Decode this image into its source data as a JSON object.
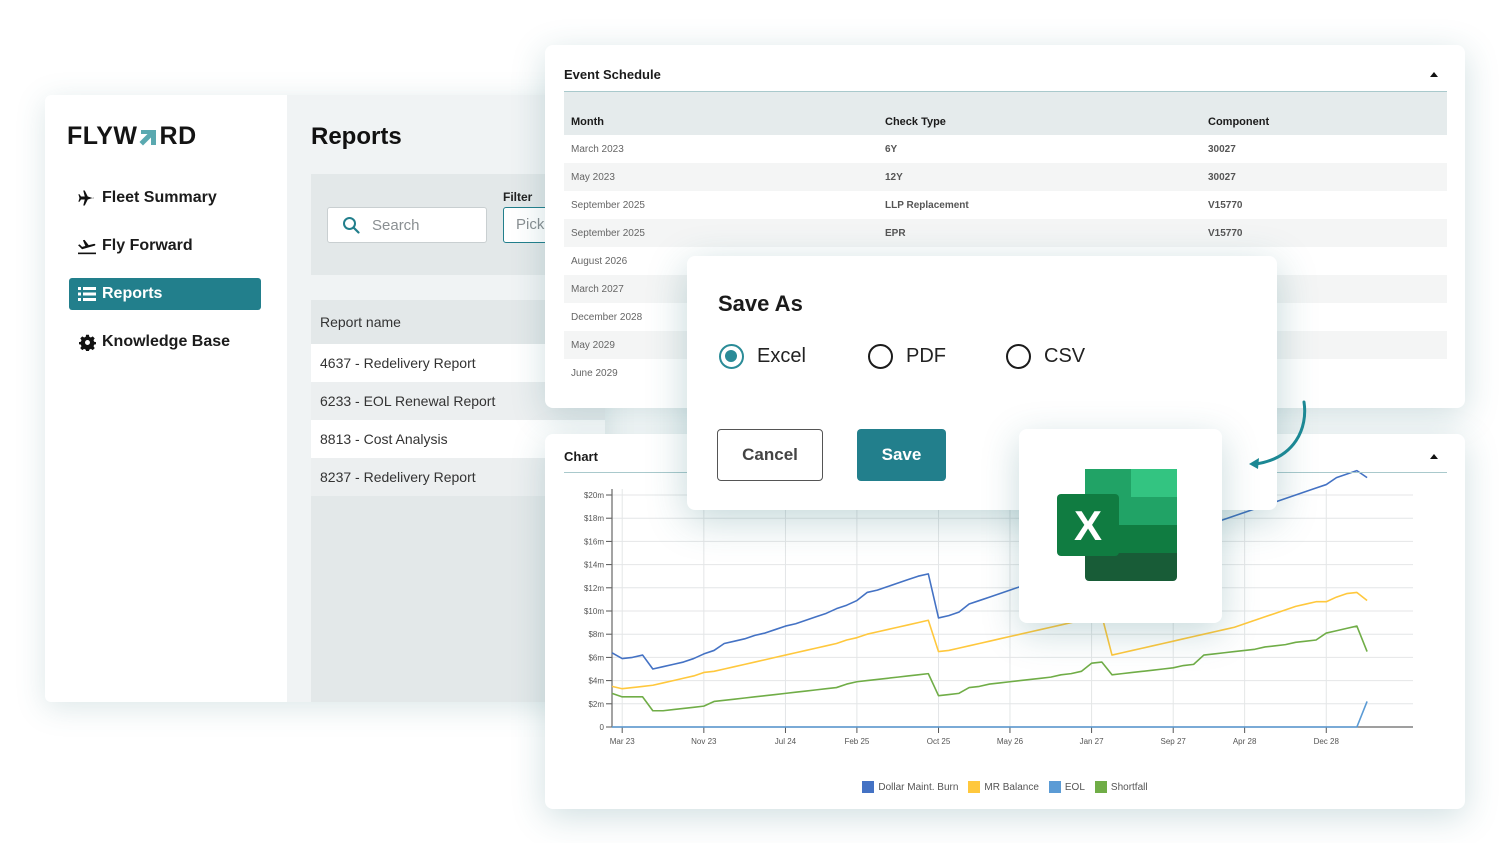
{
  "app": {
    "logo": {
      "left": "FLYW",
      "right": "RD",
      "accent": "#5aa9b0"
    },
    "sidebar": {
      "items": [
        {
          "label": "Fleet Summary",
          "icon": "plane-icon",
          "active": false
        },
        {
          "label": "Fly Forward",
          "icon": "plane-departure-icon",
          "active": false
        },
        {
          "label": "Reports",
          "icon": "list-icon",
          "active": true
        },
        {
          "label": "Knowledge Base",
          "icon": "gear-icon",
          "active": false
        }
      ]
    },
    "main": {
      "title": "Reports",
      "search": {
        "placeholder": "Search"
      },
      "filter": {
        "label": "Filter",
        "placeholder": "Pick"
      },
      "report_table": {
        "header": "Report name",
        "rows": [
          "4637 - Redelivery Report",
          "6233 - EOL Renewal Report",
          "8813 - Cost Analysis",
          "8237 - Redelivery Report"
        ]
      }
    }
  },
  "event_schedule": {
    "title": "Event Schedule",
    "columns": [
      "Month",
      "Check Type",
      "Component"
    ],
    "rows": [
      [
        "March 2023",
        "6Y",
        "30027"
      ],
      [
        "May 2023",
        "12Y",
        "30027"
      ],
      [
        "September 2025",
        "LLP Replacement",
        "V15770"
      ],
      [
        "September 2025",
        "EPR",
        "V15770"
      ],
      [
        "August 2026",
        "",
        ""
      ],
      [
        "March 2027",
        "",
        ""
      ],
      [
        "December 2028",
        "",
        ""
      ],
      [
        "May 2029",
        "",
        ""
      ],
      [
        "June 2029",
        "",
        ""
      ]
    ]
  },
  "dialog": {
    "title": "Save As",
    "options": [
      "Excel",
      "PDF",
      "CSV"
    ],
    "selected": "Excel",
    "cancel_label": "Cancel",
    "save_label": "Save"
  },
  "excel_card": {
    "icon": "excel-icon",
    "letter": "X"
  },
  "colors": {
    "accent": "#227f8c",
    "burn": "#4472c4",
    "mr_balance": "#ffc83d",
    "eol": "#5b9bd5",
    "shortfall": "#70ad47"
  },
  "chart_panel": {
    "title": "Chart"
  },
  "chart_data": {
    "type": "line",
    "title": "Chart",
    "xlabel": "",
    "ylabel": "",
    "ylim": [
      0,
      20
    ],
    "y_unit": "$m",
    "y_ticks": [
      "0",
      "$2m",
      "$4m",
      "$6m",
      "$8m",
      "$10m",
      "$12m",
      "$14m",
      "$16m",
      "$18m",
      "$20m"
    ],
    "x_ticks": [
      "Mar 23",
      "Nov 23",
      "Jul 24",
      "Feb 25",
      "Oct 25",
      "May 26",
      "Jan 27",
      "Sep 27",
      "Apr 28",
      "Dec 28"
    ],
    "x_tick_month_index": [
      1,
      9,
      17,
      24,
      32,
      39,
      47,
      55,
      62,
      70
    ],
    "x_range_months": [
      0,
      78.5
    ],
    "grid": true,
    "legend_position": "bottom",
    "x": [
      "Feb 23",
      "Mar 23",
      "Apr 23",
      "May 23",
      "Jun 23",
      "Jul 23",
      "Aug 23",
      "Sep 23",
      "Oct 23",
      "Nov 23",
      "Dec 23",
      "Jan 24",
      "Feb 24",
      "Mar 24",
      "Apr 24",
      "May 24",
      "Jun 24",
      "Jul 24",
      "Aug 24",
      "Sep 24",
      "Oct 24",
      "Nov 24",
      "Dec 24",
      "Jan 25",
      "Feb 25",
      "Mar 25",
      "Apr 25",
      "May 25",
      "Jun 25",
      "Jul 25",
      "Aug 25",
      "Sep 25",
      "Oct 25",
      "Nov 25",
      "Dec 25",
      "Jan 26",
      "Feb 26",
      "Mar 26",
      "Apr 26",
      "May 26",
      "Jun 26",
      "Jul 26",
      "Aug 26",
      "Sep 26",
      "Oct 26",
      "Nov 26",
      "Dec 26",
      "Jan 27",
      "Feb 27",
      "Mar 27",
      "Apr 27",
      "May 27",
      "Jun 27",
      "Jul 27",
      "Aug 27",
      "Sep 27",
      "Oct 27",
      "Nov 27",
      "Dec 27",
      "Jan 28",
      "Feb 28",
      "Mar 28",
      "Apr 28",
      "May 28",
      "Jun 28",
      "Jul 28",
      "Aug 28",
      "Sep 28",
      "Oct 28",
      "Nov 28",
      "Dec 28",
      "Jan 29",
      "Feb 29",
      "Mar 29",
      "Apr 29"
    ],
    "series": [
      {
        "name": "Dollar Maint. Burn",
        "color": "#4472c4",
        "values": [
          6.4,
          5.9,
          6.0,
          6.2,
          5.0,
          5.2,
          5.4,
          5.6,
          5.9,
          6.3,
          6.6,
          7.2,
          7.4,
          7.6,
          7.9,
          8.1,
          8.4,
          8.7,
          8.9,
          9.2,
          9.5,
          9.8,
          10.2,
          10.5,
          10.9,
          11.6,
          11.8,
          12.1,
          12.4,
          12.7,
          13.0,
          13.2,
          9.4,
          9.6,
          9.9,
          10.6,
          10.9,
          11.2,
          11.5,
          11.8,
          12.1,
          12.4,
          12.6,
          12.9,
          13.2,
          13.5,
          13.8,
          14.2,
          14.4,
          14.6,
          14.9,
          15.2,
          15.5,
          15.8,
          16.1,
          16.5,
          16.8,
          17.1,
          17.4,
          17.6,
          17.9,
          18.2,
          18.5,
          18.8,
          19.1,
          19.4,
          19.7,
          20.0,
          20.3,
          20.6,
          20.9,
          21.5,
          21.8,
          22.1,
          21.5
        ]
      },
      {
        "name": "MR Balance",
        "color": "#ffc83d",
        "values": [
          3.5,
          3.3,
          3.4,
          3.5,
          3.6,
          3.8,
          4.0,
          4.2,
          4.4,
          4.7,
          4.8,
          5.0,
          5.2,
          5.4,
          5.6,
          5.8,
          6.0,
          6.2,
          6.4,
          6.6,
          6.8,
          7.0,
          7.2,
          7.5,
          7.7,
          8.0,
          8.2,
          8.4,
          8.6,
          8.8,
          9.0,
          9.2,
          6.5,
          6.6,
          6.8,
          7.0,
          7.2,
          7.4,
          7.6,
          7.8,
          8.0,
          8.2,
          8.4,
          8.6,
          8.8,
          9.0,
          9.2,
          9.4,
          9.6,
          6.2,
          6.4,
          6.6,
          6.8,
          7.0,
          7.2,
          7.4,
          7.6,
          7.8,
          8.0,
          8.2,
          8.4,
          8.6,
          8.9,
          9.2,
          9.5,
          9.8,
          10.1,
          10.4,
          10.6,
          10.8,
          10.8,
          11.2,
          11.5,
          11.6,
          10.9
        ]
      },
      {
        "name": "EOL",
        "color": "#5b9bd5",
        "values": [
          0,
          0,
          0,
          0,
          0,
          0,
          0,
          0,
          0,
          0,
          0,
          0,
          0,
          0,
          0,
          0,
          0,
          0,
          0,
          0,
          0,
          0,
          0,
          0,
          0,
          0,
          0,
          0,
          0,
          0,
          0,
          0,
          0,
          0,
          0,
          0,
          0,
          0,
          0,
          0,
          0,
          0,
          0,
          0,
          0,
          0,
          0,
          0,
          0,
          0,
          0,
          0,
          0,
          0,
          0,
          0,
          0,
          0,
          0,
          0,
          0,
          0,
          0,
          0,
          0,
          0,
          0,
          0,
          0,
          0,
          0,
          0,
          0,
          0,
          2.2
        ]
      },
      {
        "name": "Shortfall",
        "color": "#70ad47",
        "values": [
          2.9,
          2.6,
          2.6,
          2.6,
          1.4,
          1.4,
          1.5,
          1.6,
          1.7,
          1.8,
          2.2,
          2.3,
          2.4,
          2.5,
          2.6,
          2.7,
          2.8,
          2.9,
          3.0,
          3.1,
          3.2,
          3.3,
          3.4,
          3.7,
          3.9,
          4.0,
          4.1,
          4.2,
          4.3,
          4.4,
          4.5,
          4.6,
          2.7,
          2.8,
          2.9,
          3.4,
          3.5,
          3.7,
          3.8,
          3.9,
          4.0,
          4.1,
          4.2,
          4.3,
          4.5,
          4.6,
          4.8,
          5.5,
          5.6,
          4.5,
          4.6,
          4.7,
          4.8,
          4.9,
          5.0,
          5.1,
          5.3,
          5.4,
          6.2,
          6.3,
          6.4,
          6.5,
          6.6,
          6.7,
          6.9,
          7.0,
          7.1,
          7.3,
          7.4,
          7.5,
          8.1,
          8.3,
          8.5,
          8.7,
          6.5
        ]
      }
    ]
  }
}
